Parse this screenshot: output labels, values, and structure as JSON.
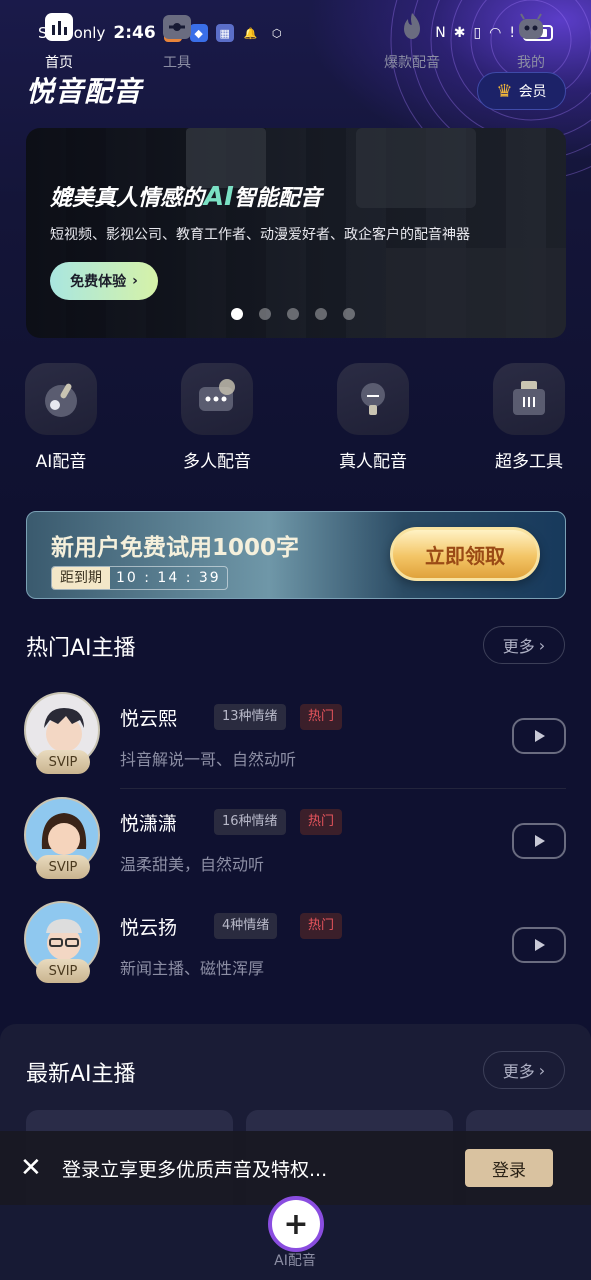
{
  "status_bar": {
    "carrier": "SOS only",
    "time": "2:46",
    "right_icons": [
      "nfc-icon",
      "bluetooth-icon",
      "vibrate-icon",
      "wifi-icon",
      "alert-icon",
      "battery-icon"
    ]
  },
  "header": {
    "title": "悦音配音",
    "vip_label": "会员"
  },
  "banner": {
    "headline_pre": "媲美真人情感的",
    "headline_ai": "AI",
    "headline_post": "智能配音",
    "subtitle": "短视频、影视公司、教育工作者、动漫爱好者、政企客户的配音神器",
    "button": "免费体验",
    "dots_total": 5,
    "dots_active": 1
  },
  "quick_nav": [
    {
      "label": "AI配音",
      "icon": "record-disc-icon"
    },
    {
      "label": "多人配音",
      "icon": "chat-bubble-icon"
    },
    {
      "label": "真人配音",
      "icon": "microphone-icon"
    },
    {
      "label": "超多工具",
      "icon": "toolbox-icon"
    }
  ],
  "promo": {
    "title": "新用户免费试用1000字",
    "countdown_label": "距到期",
    "countdown_value": "10 : 14 : 39",
    "button": "立即领取"
  },
  "hot_section": {
    "title": "热门AI主播",
    "more": "更多"
  },
  "hot_anchors": [
    {
      "name": "悦云熙",
      "emotions": "13种情绪",
      "hot": "热门",
      "desc": "抖音解说一哥、自然动听",
      "badge": "SVIP"
    },
    {
      "name": "悦潇潇",
      "emotions": "16种情绪",
      "hot": "热门",
      "desc": "温柔甜美，自然动听",
      "badge": "SVIP"
    },
    {
      "name": "悦云扬",
      "emotions": "4种情绪",
      "hot": "热门",
      "desc": "新闻主播、磁性浑厚",
      "badge": "SVIP"
    }
  ],
  "new_section": {
    "title": "最新AI主播",
    "more": "更多"
  },
  "login_bar": {
    "text": "登录立享更多优质声音及特权...",
    "button": "登录"
  },
  "tabs": [
    {
      "label": "首页",
      "icon": "home-chart-icon",
      "active": true
    },
    {
      "label": "工具",
      "icon": "tools-icon",
      "active": false
    },
    {
      "label": "AI配音",
      "icon": "plus-icon",
      "active": false
    },
    {
      "label": "爆款配音",
      "icon": "fire-icon",
      "active": false
    },
    {
      "label": "我的",
      "icon": "profile-robot-icon",
      "active": false
    }
  ],
  "colors": {
    "background": "#0f1130",
    "accent_gold": "#f3c566",
    "hot_red": "#e6545c",
    "vip_blue": "#1c2268"
  }
}
